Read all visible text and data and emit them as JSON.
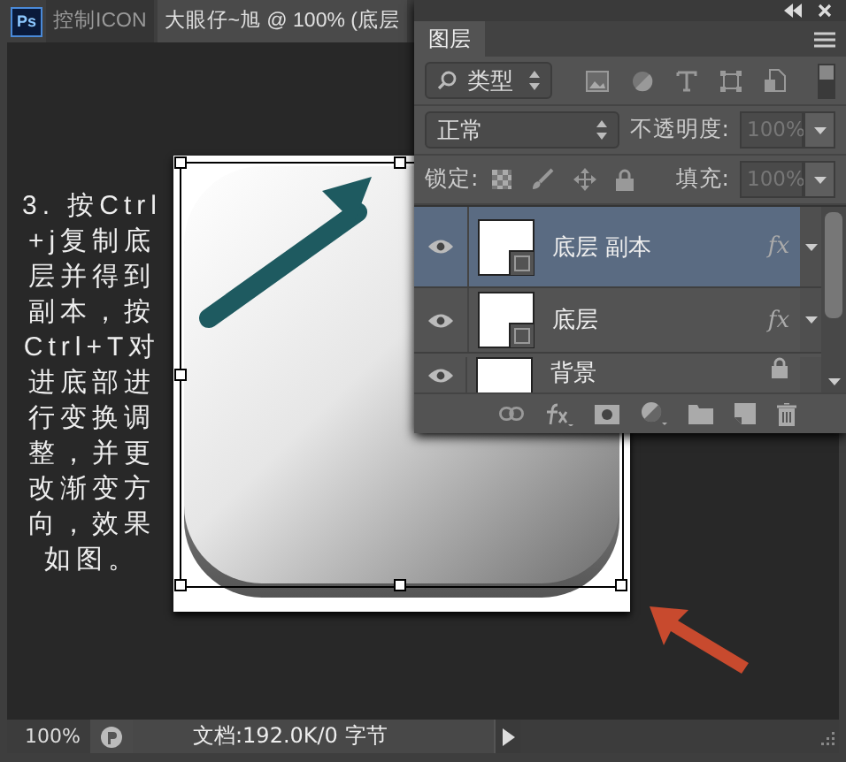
{
  "app": {
    "logo": "Ps"
  },
  "doc_tabs": [
    {
      "label": "控制ICON",
      "selected": false
    },
    {
      "label": "大眼仔~旭 @ 100% (底层",
      "selected": true
    }
  ],
  "instruction": "3. 按Ctrl+j复制底层并得到副本，按Ctrl+T对进底部进行变换调整，并更改渐变方向，效果如图。",
  "layers_panel": {
    "tab": {
      "label": "图层",
      "selected": true
    },
    "filter": {
      "value": "类型"
    },
    "blend_mode": {
      "value": "正常"
    },
    "opacity": {
      "label": "不透明度:",
      "value": "100%",
      "disabled": true
    },
    "lock": {
      "label": "锁定:"
    },
    "fill": {
      "label": "填充:",
      "value": "100%",
      "disabled": true
    },
    "layers": [
      {
        "name": "底层 副本",
        "selected": true,
        "visible": true,
        "effects": "fx",
        "locked": false,
        "kind": "shape"
      },
      {
        "name": "底层",
        "selected": false,
        "visible": true,
        "effects": "fx",
        "locked": false,
        "kind": "shape"
      },
      {
        "name": "背景",
        "selected": false,
        "visible": true,
        "locked": true,
        "kind": "background"
      }
    ]
  },
  "status_bar": {
    "zoom": "100%",
    "doc_info": "文档:192.0K/0 字节"
  }
}
